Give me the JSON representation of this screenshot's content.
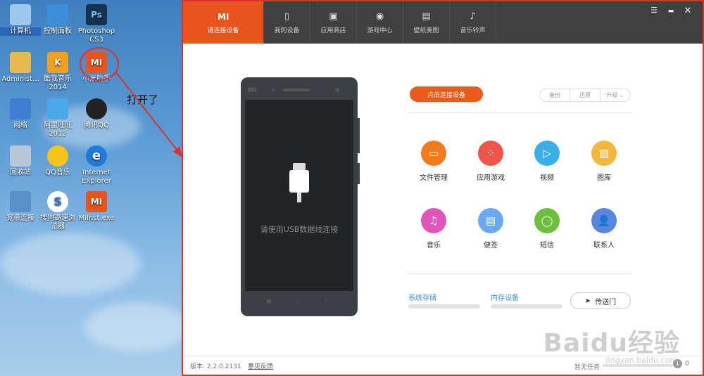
{
  "desktop": {
    "icons": [
      {
        "label": "计算机",
        "icon": "computer-icon"
      },
      {
        "label": "控制面板",
        "icon": "control-panel-icon"
      },
      {
        "label": "Photoshop CS3",
        "icon": "photoshop-icon",
        "glyph": "Ps"
      },
      {
        "label": "Administ...",
        "icon": "user-folder-icon"
      },
      {
        "label": "酷我音乐 2014",
        "icon": "kuwo-music-icon",
        "glyph": "K"
      },
      {
        "label": "小米助手",
        "icon": "mi-assistant-icon",
        "glyph": "MI"
      },
      {
        "label": "网络",
        "icon": "network-icon"
      },
      {
        "label": "阿里旺旺 2012",
        "icon": "aliwangwang-icon"
      },
      {
        "label": "腾讯QQ",
        "icon": "qq-icon"
      },
      {
        "label": "回收站",
        "icon": "recycle-bin-icon"
      },
      {
        "label": "QQ音乐",
        "icon": "qq-music-icon"
      },
      {
        "label": "Internet Explorer",
        "icon": "ie-icon",
        "glyph": "e"
      },
      {
        "label": "宽带连接",
        "icon": "broadband-icon"
      },
      {
        "label": "搜狗高速浏览器",
        "icon": "sogou-browser-icon",
        "glyph": "S"
      },
      {
        "label": "MiInst.exe",
        "icon": "mi-installer-icon",
        "glyph": "MI"
      }
    ],
    "annotation": "打开了"
  },
  "app": {
    "tabs": [
      {
        "label": "请连接设备",
        "icon": "mi-logo-icon",
        "glyph": "MI"
      },
      {
        "label": "我的设备",
        "icon": "phone-icon",
        "glyph": "▯"
      },
      {
        "label": "应用商店",
        "icon": "shopping-bag-icon",
        "glyph": "▣"
      },
      {
        "label": "游戏中心",
        "icon": "gamepad-icon",
        "glyph": "◉"
      },
      {
        "label": "壁纸美图",
        "icon": "picture-icon",
        "glyph": "▤"
      },
      {
        "label": "音乐铃声",
        "icon": "music-note-icon",
        "glyph": "♪"
      }
    ],
    "window_controls": {
      "menu": "☰",
      "minimize": "▬",
      "close": "✕"
    },
    "phone": {
      "logo": "MI",
      "message": "请使用USB数据线连接"
    },
    "connect_button": "点击连接设备",
    "segments": [
      "备份",
      "还原",
      "升级 ⌄"
    ],
    "features": [
      {
        "label": "文件管理",
        "icon": "folder-icon",
        "glyph": "▭",
        "color": "#f07a1c"
      },
      {
        "label": "应用游戏",
        "icon": "apps-icon",
        "glyph": "⁘",
        "color": "#f0554b"
      },
      {
        "label": "视频",
        "icon": "play-icon",
        "glyph": "▷",
        "color": "#3aaee8"
      },
      {
        "label": "图库",
        "icon": "gallery-icon",
        "glyph": "▨",
        "color": "#f5b73b"
      },
      {
        "label": "音乐",
        "icon": "music-icon",
        "glyph": "♫",
        "color": "#e055b8"
      },
      {
        "label": "便签",
        "icon": "note-icon",
        "glyph": "▤",
        "color": "#6aa8f0"
      },
      {
        "label": "短信",
        "icon": "message-icon",
        "glyph": "◯",
        "color": "#6cbf3e"
      },
      {
        "label": "联系人",
        "icon": "contact-icon",
        "glyph": "👤",
        "color": "#5a86e0"
      }
    ],
    "storage": {
      "system": "系统存储",
      "internal": "内存设备"
    },
    "send_button": "传送门",
    "status": {
      "version": "版本: 2.2.0.2131",
      "feedback": "意见反馈",
      "tasks": "暂无任务",
      "count": "0"
    },
    "watermark": "Baidu经验",
    "watermark_url": "jingyan.baidu.com"
  }
}
